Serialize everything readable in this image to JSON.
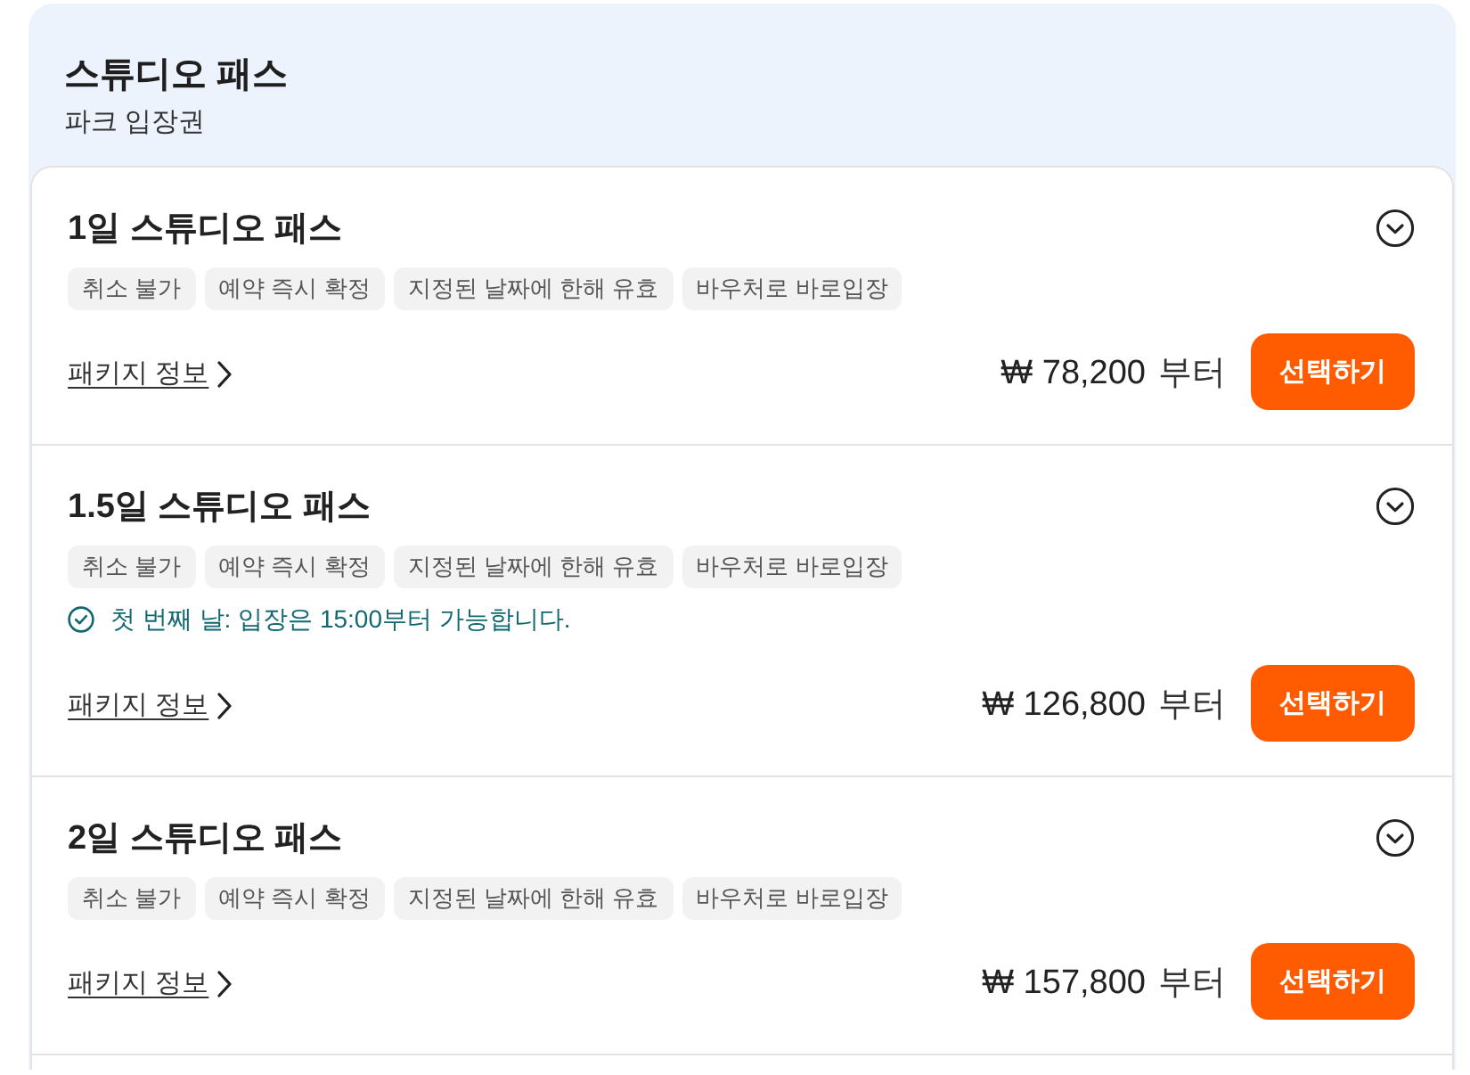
{
  "header": {
    "title": "스튜디오 패스",
    "subtitle": "파크 입장권"
  },
  "packages": [
    {
      "title": "1일 스튜디오 패스",
      "expanded": false,
      "tags": [
        "취소 불가",
        "예약 즉시 확정",
        "지정된 날짜에 한해 유효",
        "바우처로 바로입장"
      ],
      "link": "패키지 정보",
      "price": "₩ 78,200",
      "price_suffix": "부터",
      "button": "선택하기"
    },
    {
      "title": "1.5일 스튜디오 패스",
      "expanded": false,
      "tags": [
        "취소 불가",
        "예약 즉시 확정",
        "지정된 날짜에 한해 유효",
        "바우처로 바로입장"
      ],
      "note": "첫 번째 날: 입장은 15:00부터 가능합니다.",
      "link": "패키지 정보",
      "price": "₩ 126,800",
      "price_suffix": "부터",
      "button": "선택하기"
    },
    {
      "title": "2일 스튜디오 패스",
      "expanded": false,
      "tags": [
        "취소 불가",
        "예약 즉시 확정",
        "지정된 날짜에 한해 유효",
        "바우처로 바로입장"
      ],
      "link": "패키지 정보",
      "price": "₩ 157,800",
      "price_suffix": "부터",
      "button": "선택하기"
    }
  ]
}
